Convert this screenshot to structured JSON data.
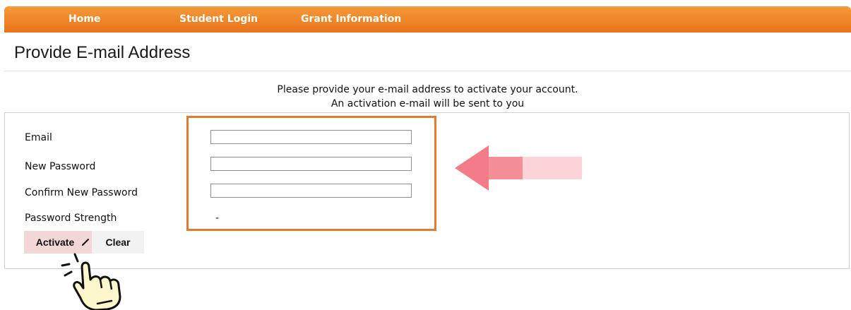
{
  "nav": {
    "items": [
      {
        "label": "Home"
      },
      {
        "label": "Student Login"
      },
      {
        "label": "Grant Information"
      }
    ]
  },
  "page": {
    "title": "Provide E-mail Address"
  },
  "instructions": {
    "line1": "Please provide your e-mail address to activate your account.",
    "line2": "An activation e-mail will be sent to you"
  },
  "form": {
    "email_label": "Email",
    "new_password_label": "New Password",
    "confirm_password_label": "Confirm New Password",
    "strength_label": "Password Strength",
    "strength_value": "-",
    "email_value": "",
    "new_password_value": "",
    "confirm_password_value": ""
  },
  "buttons": {
    "activate_label": "Activate",
    "clear_label": "Clear"
  },
  "icons": {
    "nav_gradient_top": "#f59a3a",
    "nav_gradient_bottom": "#e8741a",
    "highlight_color": "#e27a34",
    "arrow_color": "#f47c88",
    "hand": "pointing-hand-icon",
    "arrow": "left-arrow-icon",
    "pencil": "pencil-icon"
  }
}
